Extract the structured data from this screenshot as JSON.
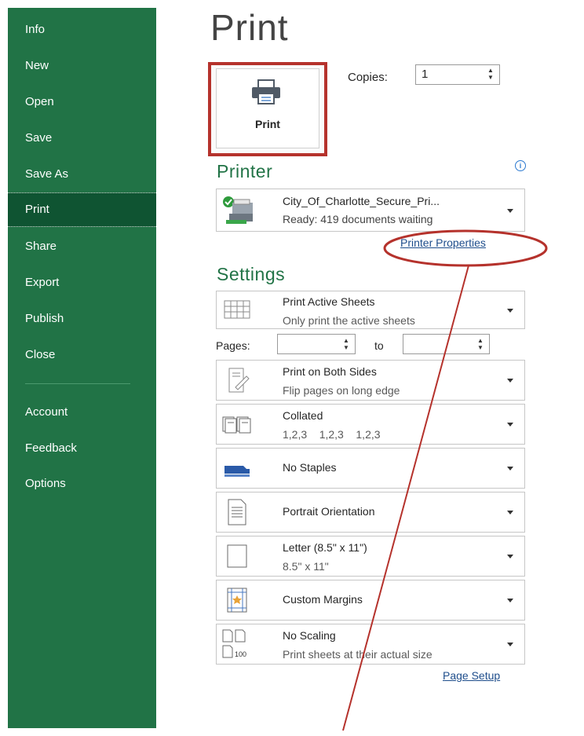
{
  "sidebar": {
    "items": [
      {
        "label": "Info"
      },
      {
        "label": "New"
      },
      {
        "label": "Open"
      },
      {
        "label": "Save"
      },
      {
        "label": "Save As"
      },
      {
        "label": "Print"
      },
      {
        "label": "Share"
      },
      {
        "label": "Export"
      },
      {
        "label": "Publish"
      },
      {
        "label": "Close"
      },
      {
        "label": "Account"
      },
      {
        "label": "Feedback"
      },
      {
        "label": "Options"
      }
    ],
    "active": "Print",
    "colors": {
      "background": "#217346",
      "active": "#0f5432"
    }
  },
  "header": {
    "title": "Print"
  },
  "print_button": {
    "label": "Print",
    "icon": "printer-icon"
  },
  "copies": {
    "label": "Copies:",
    "value": "1"
  },
  "printer": {
    "section_title": "Printer",
    "name": "City_Of_Charlotte_Secure_Pri...",
    "status": "Ready: 419 documents waiting",
    "properties_link": "Printer Properties",
    "icon": "printer-ready-icon"
  },
  "settings": {
    "section_title": "Settings",
    "what_to_print": {
      "title": "Print Active Sheets",
      "subtitle": "Only print the active sheets"
    },
    "pages": {
      "label": "Pages:",
      "to_label": "to",
      "from_value": "",
      "to_value": ""
    },
    "sides": {
      "title": "Print on Both Sides",
      "subtitle": "Flip pages on long edge"
    },
    "collation": {
      "title": "Collated",
      "subtitle": "1,2,3    1,2,3    1,2,3"
    },
    "staples": {
      "title": "No Staples"
    },
    "orientation": {
      "title": "Portrait Orientation"
    },
    "paper": {
      "title": "Letter (8.5\" x 11\")",
      "subtitle": "8.5\" x 11\""
    },
    "margins": {
      "title": "Custom Margins"
    },
    "scaling": {
      "title": "No Scaling",
      "subtitle": "Print sheets at their actual size",
      "icon_text": "100"
    },
    "page_setup_link": "Page Setup"
  },
  "colors": {
    "accent": "#217346",
    "highlight_annotation": "#b5322c",
    "link": "#1f4e8c"
  }
}
